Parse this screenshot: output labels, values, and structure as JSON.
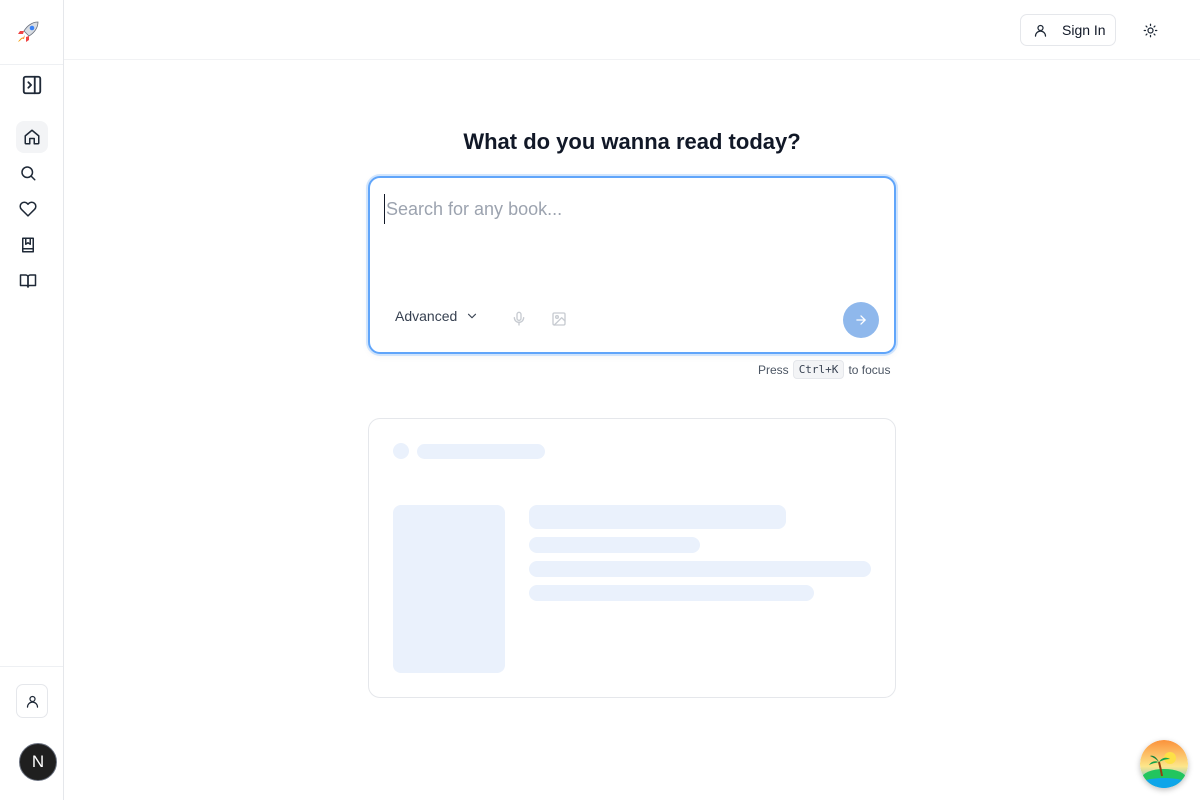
{
  "sidebar": {
    "logo_icon": "rocket-icon",
    "items": [
      {
        "icon": "panel-toggle-icon",
        "label": "Toggle sidebar"
      },
      {
        "icon": "home-icon",
        "label": "Home",
        "active": true
      },
      {
        "icon": "search-icon",
        "label": "Search"
      },
      {
        "icon": "heart-icon",
        "label": "Favorites"
      },
      {
        "icon": "bookmark-book-icon",
        "label": "Saved books"
      },
      {
        "icon": "open-book-icon",
        "label": "Reading"
      }
    ],
    "user_icon": "user-icon",
    "avatar_letter": "N"
  },
  "header": {
    "signin_label": "Sign In",
    "theme_icon": "sun-icon"
  },
  "main": {
    "headline": "What do you wanna read today?",
    "search": {
      "placeholder": "Search for any book...",
      "value": ""
    },
    "advanced_label": "Advanced",
    "hint": {
      "prefix": "Press",
      "shortcut": "Ctrl+K",
      "suffix": "to focus"
    }
  },
  "colors": {
    "accent": "#60a5fa",
    "submit": "#8fb8ec",
    "skeleton": "#eaf1fc"
  }
}
